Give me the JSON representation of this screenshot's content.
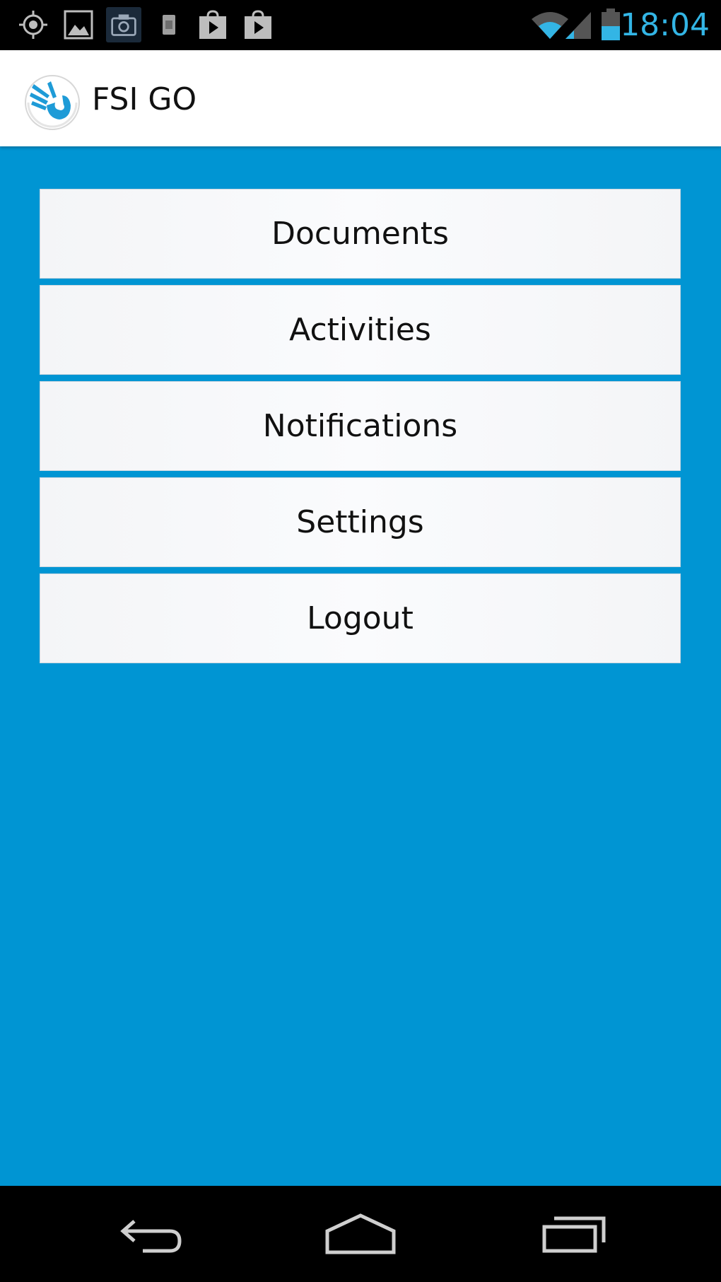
{
  "status_bar": {
    "icons": [
      "gps-icon",
      "gallery-icon",
      "camera-icon",
      "sim-card-icon",
      "play-store-icon",
      "play-store-icon"
    ],
    "signal_icons": [
      "wifi-icon",
      "cell-signal-icon",
      "battery-icon"
    ],
    "time": "18:04",
    "clock_color": "#33b5e5"
  },
  "action_bar": {
    "logo_icon": "hand-logo-icon",
    "title": "FSI GO"
  },
  "menu": {
    "items": [
      {
        "label": "Documents"
      },
      {
        "label": "Activities"
      },
      {
        "label": "Notifications"
      },
      {
        "label": "Settings"
      },
      {
        "label": "Logout"
      }
    ]
  },
  "nav_bar": {
    "icons": [
      "back-icon",
      "home-icon",
      "recent-apps-icon"
    ]
  },
  "colors": {
    "background": "#0095d3",
    "menu_item": "#f7f8fa",
    "action_bar": "#ffffff",
    "accent": "#33b5e5"
  }
}
